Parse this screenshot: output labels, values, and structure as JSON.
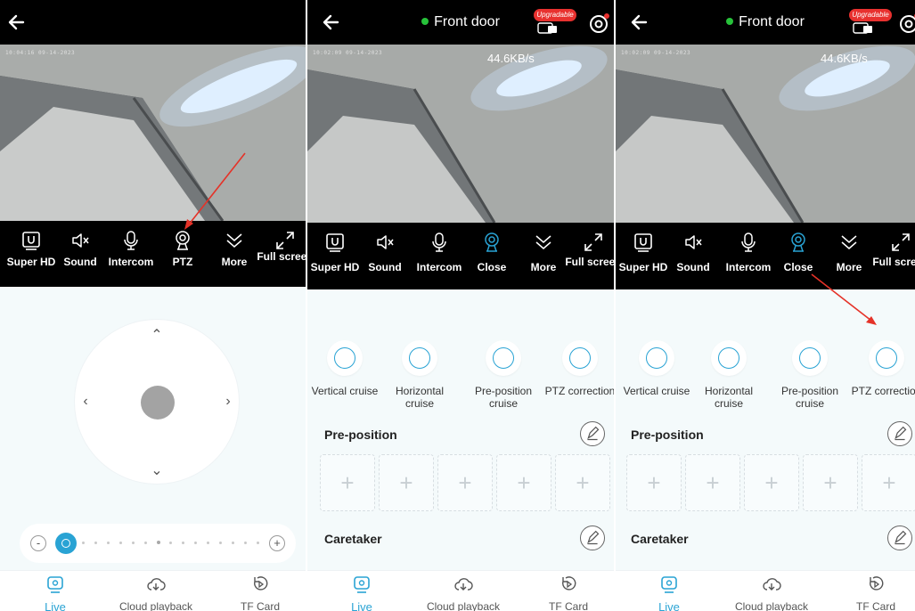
{
  "panels": [
    {
      "osd": "10:04:16 09-14-2023",
      "toolbar": [
        "Super HD",
        "Sound",
        "Intercom",
        "PTZ",
        "More",
        "Full screen"
      ],
      "nav": [
        "Live",
        "Cloud playback",
        "TF Card"
      ],
      "zoom": {
        "minus": "-",
        "plus": "+",
        "level": 0.0
      }
    },
    {
      "title": "Front door",
      "upgrade_badge": "Upgradable",
      "osd": "10:02:09 09-14-2023",
      "speed": "44.6KB/s",
      "toolbar": [
        "Super HD",
        "Sound",
        "Intercom",
        "Close",
        "More",
        "Full screen"
      ],
      "features": [
        "Vertical cruise",
        "Horizontal cruise",
        "Pre-position cruise",
        "PTZ correction"
      ],
      "preposition": "Pre-position",
      "caretaker": "Caretaker",
      "slot": "+",
      "nav": [
        "Live",
        "Cloud playback",
        "TF Card"
      ]
    },
    {
      "title": "Front door",
      "upgrade_badge": "Upgradable",
      "osd": "10:02:09 09-14-2023",
      "speed": "44.6KB/s",
      "toolbar": [
        "Super HD",
        "Sound",
        "Intercom",
        "Close",
        "More",
        "Full screen"
      ],
      "features": [
        "Vertical cruise",
        "Horizontal cruise",
        "Pre-position cruise",
        "PTZ correction"
      ],
      "preposition": "Pre-position",
      "caretaker": "Caretaker",
      "slot": "+",
      "nav": [
        "Live",
        "Cloud playback",
        "TF Card"
      ]
    }
  ],
  "colors": {
    "accent": "#29a3d4",
    "online": "#27c23a",
    "badge": "#e8312f",
    "annotation": "#e53228"
  },
  "icons": [
    "back-arrow-icon",
    "upgrade-camera-icon",
    "settings-icon",
    "hd-icon",
    "speaker-muted-icon",
    "microphone-icon",
    "ptz-camera-icon",
    "chevron-down-double-icon",
    "fullscreen-icon",
    "live-icon",
    "cloud-playback-icon",
    "tf-card-icon"
  ]
}
